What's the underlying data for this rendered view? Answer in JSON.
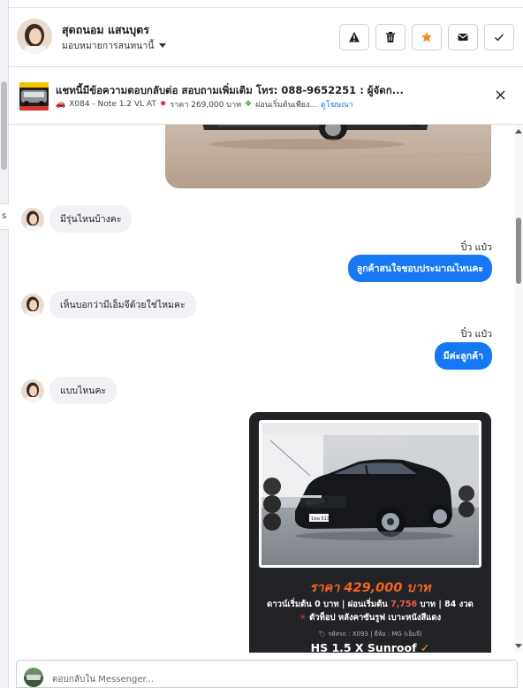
{
  "header": {
    "contact_name": "สุดถนอม แสนบุตร",
    "assign_label": "มอบหมายการสนทนานี้",
    "actions": [
      {
        "icon": "warning-icon"
      },
      {
        "icon": "trash-icon"
      },
      {
        "icon": "star-icon",
        "color": "#f28c28"
      },
      {
        "icon": "envelope-icon"
      },
      {
        "icon": "check-icon"
      }
    ]
  },
  "ad_banner": {
    "title": "แชทนี้มีข้อความตอบกลับต่อ สอบถามเพิ่มเติม โทร: 088-9652251 : ผู้จัดก...",
    "model": "X084 - Note 1.2 VL AT",
    "price": "ราคา 269,000 บาท",
    "installment": "ผ่อนเริ่มต้นเพียง...",
    "link": "ดูโฆษณา"
  },
  "messages": [
    {
      "dir": "in",
      "text": "มีรุ่นไหนบ้างคะ"
    },
    {
      "dir": "out",
      "sender": "ปิ๋ว แป๋ว",
      "text": "ลูกค้าสนใจชอบประมาณไหนคะ"
    },
    {
      "dir": "in",
      "text": "เห็นบอกว่ามีเอ็มจีด้วยใช่ไหมคะ"
    },
    {
      "dir": "out",
      "sender": "ปิ๋ว แป๋ว",
      "text": "มีค่ะลูกค้า"
    },
    {
      "dir": "in",
      "text": "แบบไหนคะ"
    }
  ],
  "car_card": {
    "price": "ราคา 429,000 บาท",
    "finance_prefix": "ดาวน์เริ่มต้น 0 บาท | ผ่อนเริ่มต้น",
    "finance_amount": "7,756",
    "finance_suffix": "บาท | 84 งวด",
    "features": "ตัวท็อป หลังคาซันรูฟ เบาะหนังสีแดง",
    "meta": "รหัสรถ : X093 | ยี่ห้อ : MG (เอ็มจี)",
    "model": "HS 1.5 X Sunroof",
    "plate": "1ขษ 513"
  },
  "composer": {
    "placeholder": "ตอบกลับใน Messenger..."
  },
  "left_tab_label": "s",
  "colors": {
    "brand_blue": "#1877f2",
    "bubble_in": "#f0f2f5",
    "price_orange": "#f26522"
  }
}
